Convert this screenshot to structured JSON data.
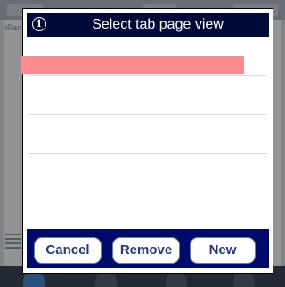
{
  "background": {
    "page_label": "iPad"
  },
  "dialog": {
    "title": "Select tab page view",
    "info_icon": "info-icon",
    "selected_row_color": "#ff8a8f",
    "buttons": {
      "cancel_label": "Cancel",
      "remove_label": "Remove",
      "new_label": "New"
    }
  },
  "colors": {
    "title_bar": "#000a36",
    "button_bar": "#000a6b",
    "button_text": "#233a7a"
  }
}
